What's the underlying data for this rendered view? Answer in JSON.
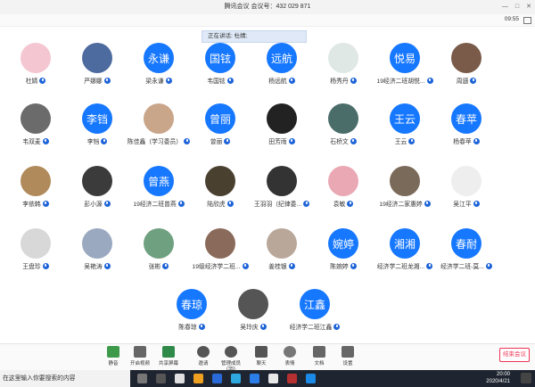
{
  "window": {
    "title": "腾讯会议  会议号：432 029 871",
    "minimize": "—",
    "maximize": "□",
    "close": "✕"
  },
  "timer": "09:55",
  "speaking": "正在讲话: 杜婧;",
  "participants": [
    {
      "name": "杜婧",
      "avatar_text": "",
      "avatar_color": "#f4c6d1"
    },
    {
      "name": "严娜娜",
      "avatar_text": "",
      "avatar_color": "#4d6b9e"
    },
    {
      "name": "梁永谦",
      "avatar_text": "永谦",
      "avatar_color": "#1677ff"
    },
    {
      "name": "韦国铉",
      "avatar_text": "国铉",
      "avatar_color": "#1677ff"
    },
    {
      "name": "杨远航",
      "avatar_text": "远航",
      "avatar_color": "#1677ff"
    },
    {
      "name": "杨秀丹",
      "avatar_text": "",
      "avatar_color": "#dfe8e4"
    },
    {
      "name": "19经济二班胡悦...",
      "avatar_text": "悦易",
      "avatar_color": "#1677ff"
    },
    {
      "name": "周逦",
      "avatar_text": "",
      "avatar_color": "#7a5a48"
    },
    {
      "name": "韦双麦",
      "avatar_text": "",
      "avatar_color": "#6b6b6b"
    },
    {
      "name": "李铛",
      "avatar_text": "李铛",
      "avatar_color": "#1677ff"
    },
    {
      "name": "陈佳鑫（学习委员）",
      "avatar_text": "",
      "avatar_color": "#c9a58a"
    },
    {
      "name": "曾丽",
      "avatar_text": "曾丽",
      "avatar_color": "#1677ff"
    },
    {
      "name": "田芳雨",
      "avatar_text": "",
      "avatar_color": "#222"
    },
    {
      "name": "石桥文",
      "avatar_text": "",
      "avatar_color": "#4a6d6a"
    },
    {
      "name": "王云",
      "avatar_text": "王云",
      "avatar_color": "#1677ff"
    },
    {
      "name": "杨春苹",
      "avatar_text": "春苹",
      "avatar_color": "#1677ff"
    },
    {
      "name": "李依韩",
      "avatar_text": "",
      "avatar_color": "#b08a5a"
    },
    {
      "name": "彭小源",
      "avatar_text": "",
      "avatar_color": "#3b3b3b"
    },
    {
      "name": "19经济二班曾燕",
      "avatar_text": "曾燕",
      "avatar_color": "#1677ff"
    },
    {
      "name": "陆欣虎",
      "avatar_text": "",
      "avatar_color": "#4a4030"
    },
    {
      "name": "王羽羽（纪律委...",
      "avatar_text": "",
      "avatar_color": "#333"
    },
    {
      "name": "袁敏",
      "avatar_text": "",
      "avatar_color": "#e9a8b4"
    },
    {
      "name": "19经济二家惠婷",
      "avatar_text": "",
      "avatar_color": "#7a6a5a"
    },
    {
      "name": "吴江平",
      "avatar_text": "",
      "avatar_color": "#eeeeee"
    },
    {
      "name": "王盘珍",
      "avatar_text": "",
      "avatar_color": "#d8d8d8"
    },
    {
      "name": "吴艳涛",
      "avatar_text": "",
      "avatar_color": "#9aa8c0"
    },
    {
      "name": "张彬",
      "avatar_text": "",
      "avatar_color": "#6fa080"
    },
    {
      "name": "19级经济学二班...",
      "avatar_text": "",
      "avatar_color": "#8a6a5a"
    },
    {
      "name": "姜桂银",
      "avatar_text": "",
      "avatar_color": "#b9a79a"
    },
    {
      "name": "陈婉婷",
      "avatar_text": "婉婷",
      "avatar_color": "#1677ff"
    },
    {
      "name": "经济学二班龙湘...",
      "avatar_text": "湘湘",
      "avatar_color": "#1677ff"
    },
    {
      "name": "经济学二班-莫...",
      "avatar_text": "春耐",
      "avatar_color": "#1677ff"
    },
    {
      "name": "陈春琼",
      "avatar_text": "春琼",
      "avatar_color": "#1677ff"
    },
    {
      "name": "吴玲庆",
      "avatar_text": "",
      "avatar_color": "#555"
    },
    {
      "name": "经济学二班江鑫",
      "avatar_text": "江鑫",
      "avatar_color": "#1677ff"
    }
  ],
  "toolbar": {
    "mute": "静音",
    "video": "开启视频",
    "share": "共享屏幕",
    "invite": "邀请",
    "manage": "管理成员(35)",
    "chat": "聊天",
    "emoji": "表情",
    "docs": "文档",
    "settings": "设置",
    "end": "结束会议"
  },
  "taskbar": {
    "search_placeholder": "在这里输入你要搜索的内容",
    "time": "20:00",
    "date": "2020/4/21"
  }
}
